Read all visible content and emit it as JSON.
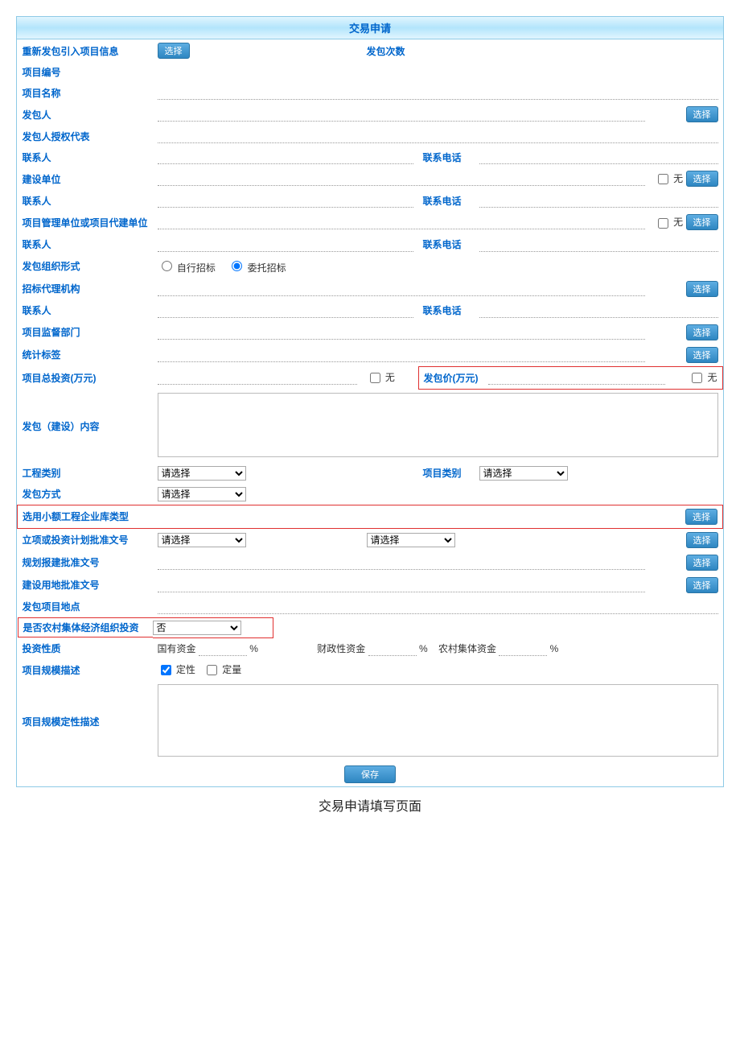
{
  "title": "交易申请",
  "caption": "交易申请填写页面",
  "labels": {
    "reimport": "重新发包引入项目信息",
    "fabaoCount": "发包次数",
    "projectNo": "项目编号",
    "projectName": "项目名称",
    "sender": "发包人",
    "senderAuth": "发包人授权代表",
    "contact": "联系人",
    "phone": "联系电话",
    "buildUnit": "建设单位",
    "pmOrAgentUnit": "项目管理单位或项目代建单位",
    "orgForm": "发包组织形式",
    "bidAgency": "招标代理机构",
    "supervision": "项目监督部门",
    "statTag": "统计标签",
    "totalInvest": "项目总投资(万元)",
    "contractPrice": "发包价(万元)",
    "buildContent": "发包（建设）内容",
    "projClass": "工程类别",
    "projType": "项目类别",
    "contractMethod": "发包方式",
    "selectSmallEnterprise": "选用小额工程企业库类型",
    "approvalDoc": "立项或投资计划批准文号",
    "planApproval": "规划报建批准文号",
    "landApproval": "建设用地批准文号",
    "projAddress": "发包项目地点",
    "isRuralCollective": "是否农村集体经济组织投资",
    "investNature": "投资性质",
    "scaleDesc": "项目规模描述",
    "scaleQualDesc": "项目规模定性描述"
  },
  "text": {
    "none": "无",
    "selfBid": "自行招标",
    "delegateBid": "委托招标",
    "pleaseSelect": "请选择",
    "no": "否",
    "stateFund": "国有资金",
    "fiscalFund": "财政性资金",
    "ruralFund": "农村集体资金",
    "percent": "%",
    "qualitative": "定性",
    "quantitative": "定量"
  },
  "buttons": {
    "select": "选择",
    "save": "保存"
  }
}
